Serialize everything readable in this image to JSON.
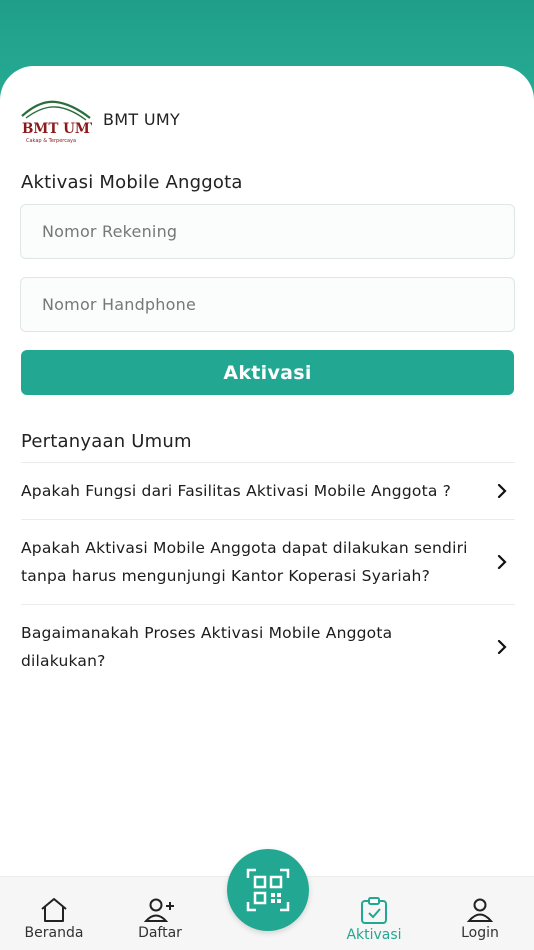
{
  "brand": {
    "name": "BMT UMY",
    "logo_text": "BMT UMY",
    "logo_tagline": "Cakap & Terpercaya"
  },
  "form": {
    "title": "Aktivasi Mobile Anggota",
    "account_placeholder": "Nomor Rekening",
    "phone_placeholder": "Nomor Handphone",
    "submit_label": "Aktivasi"
  },
  "faq": {
    "title": "Pertanyaan Umum",
    "items": [
      {
        "question": "Apakah Fungsi dari Fasilitas Aktivasi Mobile Anggota ?"
      },
      {
        "question": "Apakah Aktivasi Mobile Anggota dapat dilakukan sendiri tanpa harus mengunjungi Kantor Koperasi Syariah?"
      },
      {
        "question": "Bagaimanakah Proses Aktivasi Mobile Anggota dilakukan?"
      }
    ]
  },
  "nav": {
    "items": [
      {
        "label": "Beranda",
        "icon": "home-icon"
      },
      {
        "label": "Daftar",
        "icon": "add-user-icon"
      },
      {
        "label": "Aktivasi",
        "icon": "clipboard-check-icon",
        "active": true
      },
      {
        "label": "Login",
        "icon": "user-icon"
      }
    ],
    "fab_icon": "qr-code-icon"
  },
  "colors": {
    "accent": "#22a892",
    "header_gradient_top": "#1f9f8a",
    "logo_red": "#8b1a1a"
  }
}
